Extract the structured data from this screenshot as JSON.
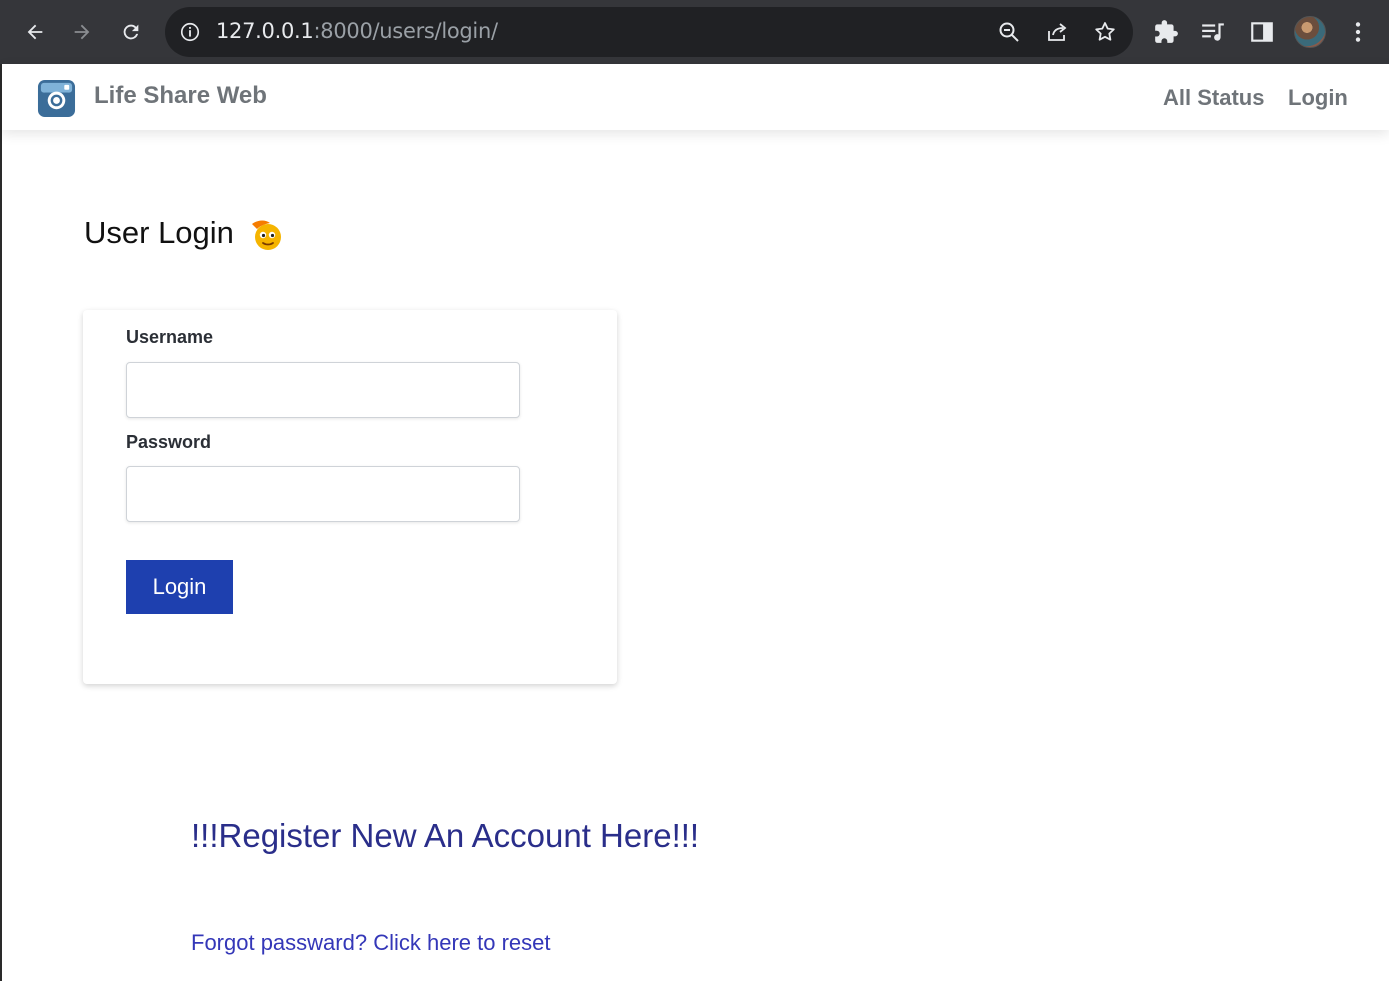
{
  "browser": {
    "url_host": "127.0.0.1",
    "url_rest": ":8000/users/login/",
    "icons": [
      "back-icon",
      "forward-icon",
      "reload-icon",
      "site-info-icon",
      "zoom-icon",
      "share-icon",
      "bookmark-star-icon",
      "extensions-icon",
      "media-icon",
      "side-panel-icon",
      "profile-avatar",
      "menu-icon"
    ]
  },
  "navbar": {
    "brand": "Life Share Web",
    "links": [
      "All Status",
      "Login"
    ]
  },
  "main": {
    "title": "User Login",
    "form": {
      "username_label": "Username",
      "username_value": "",
      "password_label": "Password",
      "password_value": "",
      "submit_label": "Login"
    },
    "register_link": "!!!Register New An Account Here!!!",
    "forgot_link": "Forgot passward? Click here to reset"
  },
  "colors": {
    "accent": "#1e40af",
    "link": "#2a2e8a",
    "chrome_bg": "#35363a"
  }
}
